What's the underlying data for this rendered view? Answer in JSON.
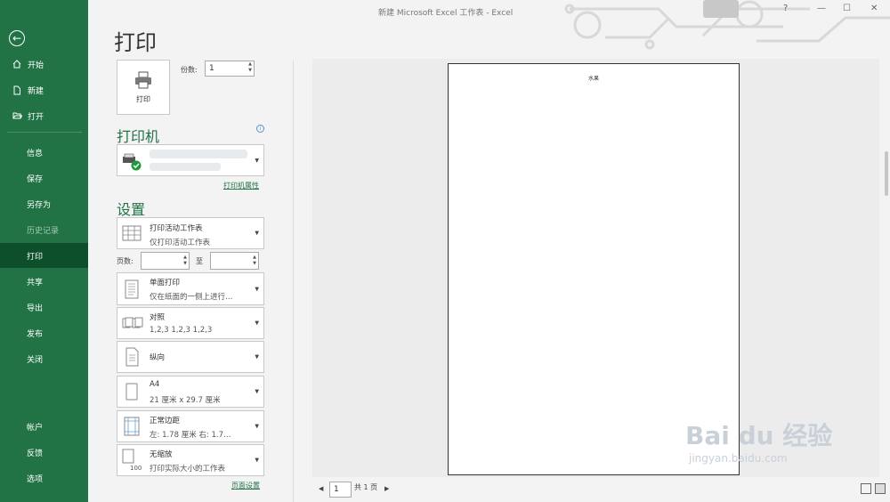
{
  "window": {
    "title": "新建 Microsoft Excel 工作表  -  Excel",
    "help": "?",
    "minimize": "—",
    "maximize": "☐",
    "close": "✕"
  },
  "sidebar": {
    "back_glyph": "←",
    "top_items": [
      {
        "label": "开始",
        "icon": "home-icon"
      },
      {
        "label": "新建",
        "icon": "new-file-icon"
      },
      {
        "label": "打开",
        "icon": "open-folder-icon"
      }
    ],
    "items": [
      "信息",
      "保存",
      "另存为",
      "历史记录",
      "打印",
      "共享",
      "导出",
      "发布",
      "关闭"
    ],
    "active": "打印",
    "disabled": "历史记录",
    "bottom_items": [
      "帐户",
      "反馈",
      "选项"
    ]
  },
  "print": {
    "title": "打印",
    "print_button_label": "打印",
    "copies_label": "份数:",
    "copies_value": "1",
    "printer_heading": "打印机",
    "printer_properties_link": "打印机属性",
    "settings_heading": "设置",
    "settings": [
      {
        "line1": "打印活动工作表",
        "line2": "仅打印活动工作表",
        "icon": "worksheet-icon"
      },
      {
        "line1": "单面打印",
        "line2": "仅在纸面的一侧上进行…",
        "icon": "one-sided-icon"
      },
      {
        "line1": "对照",
        "line2": "1,2,3    1,2,3    1,2,3",
        "icon": "collate-icon"
      },
      {
        "line1": "纵向",
        "line2": "",
        "icon": "portrait-icon"
      },
      {
        "line1": "A4",
        "line2": "21 厘米 x 29.7 厘米",
        "icon": "paper-size-icon"
      },
      {
        "line1": "正常边距",
        "line2": "左: 1.78 厘米    右: 1.7…",
        "icon": "margins-icon"
      },
      {
        "line1": "无缩放",
        "line2": "打印实际大小的工作表",
        "icon": "no-scaling-icon"
      }
    ],
    "pages_label": "页数:",
    "pages_to_label": "至",
    "page_setup_link": "页面设置"
  },
  "preview": {
    "page_text": "水果",
    "current_page": "1",
    "total_pages_text": "共 1 页",
    "prev_glyph": "◀",
    "next_glyph": "▶"
  },
  "watermark": {
    "brand": "Bai  du 经验",
    "url": "jingyan.baidu.com"
  },
  "colors": {
    "accent": "#217346",
    "active_nav": "#0e4f2b"
  }
}
